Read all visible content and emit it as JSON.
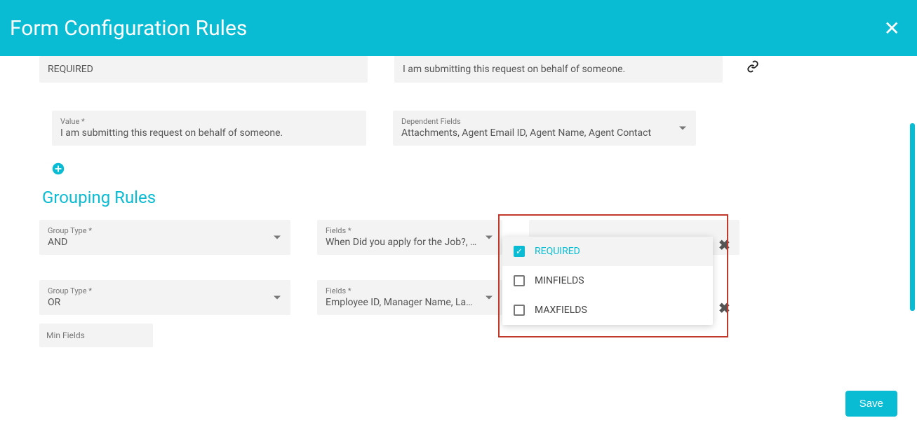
{
  "header": {
    "title": "Form Configuration Rules"
  },
  "topRow": {
    "ruleTypeValue": "REQUIRED",
    "fieldValue": "I am submitting this request on behalf of someone."
  },
  "valueField": {
    "label": "Value *",
    "value": "I am submitting this request on behalf of someone."
  },
  "dependentField": {
    "label": "Dependent Fields",
    "value": "Attachments, Agent Email ID, Agent Name, Agent Contact"
  },
  "groupingSection": {
    "title": "Grouping Rules"
  },
  "groupTypeLabel": "Group Type *",
  "fieldsLabel": "Fields *",
  "group1": {
    "typeValue": "AND",
    "fieldsValue": "When Did you apply for the Job?, …"
  },
  "group2": {
    "typeValue": "OR",
    "fieldsValue": "Employee ID, Manager Name, La…"
  },
  "minFields": {
    "label": "Min Fields"
  },
  "dropdown": {
    "opt1": "REQUIRED",
    "opt2": "MINFIELDS",
    "opt3": "MAXFIELDS"
  },
  "saveLabel": "Save"
}
